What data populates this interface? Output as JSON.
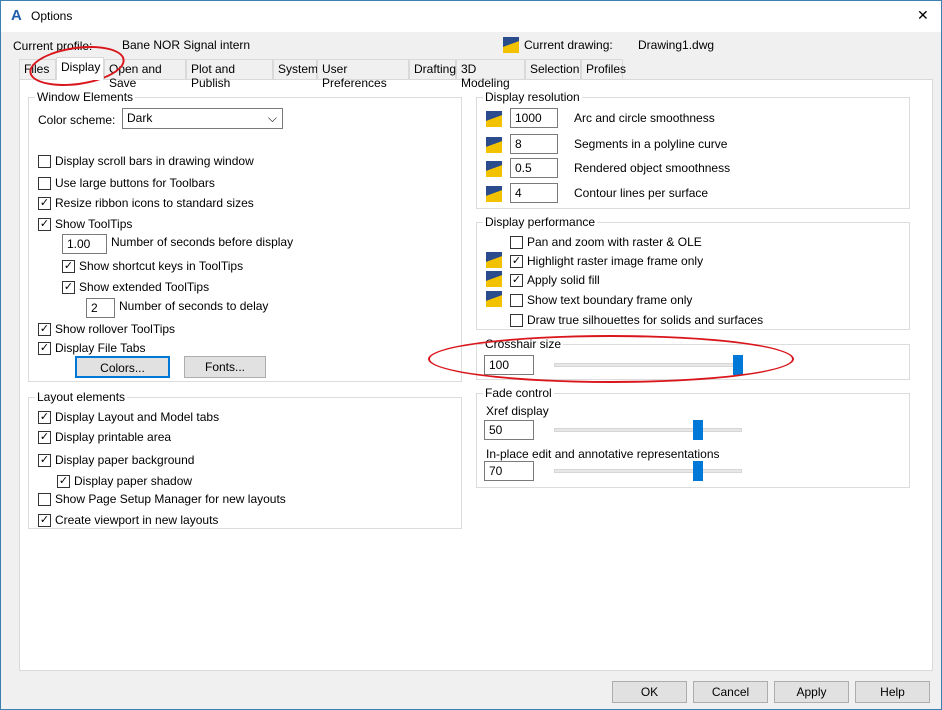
{
  "window": {
    "title": "Options",
    "close": "✕"
  },
  "header": {
    "profile_label": "Current profile:",
    "profile_value": "Bane NOR Signal intern",
    "drawing_label": "Current drawing:",
    "drawing_value": "Drawing1.dwg"
  },
  "tabs": [
    "Files",
    "Display",
    "Open and Save",
    "Plot and Publish",
    "System",
    "User Preferences",
    "Drafting",
    "3D Modeling",
    "Selection",
    "Profiles"
  ],
  "active_tab": "Display",
  "window_elements": {
    "title": "Window Elements",
    "color_scheme_label": "Color scheme:",
    "color_scheme": "Dark",
    "scroll_bars": "Display scroll bars in drawing window",
    "large_buttons": "Use large buttons for Toolbars",
    "resize_ribbon": "Resize ribbon icons to standard sizes",
    "show_tooltips": "Show ToolTips",
    "seconds_value": "1.00",
    "seconds_label": "Number of seconds before display",
    "shortcut_keys": "Show shortcut keys in ToolTips",
    "extended": "Show extended ToolTips",
    "delay_value": "2",
    "delay_label": "Number of seconds to delay",
    "rollover": "Show rollover ToolTips",
    "file_tabs": "Display File Tabs",
    "colors_btn": "Colors...",
    "fonts_btn": "Fonts..."
  },
  "layout_elements": {
    "title": "Layout elements",
    "model_tabs": "Display Layout and Model tabs",
    "printable": "Display printable area",
    "paper_bg": "Display paper background",
    "paper_shadow": "Display paper shadow",
    "page_setup": "Show Page Setup Manager for new layouts",
    "viewport": "Create viewport in new layouts"
  },
  "display_resolution": {
    "title": "Display resolution",
    "rows": [
      {
        "value": "1000",
        "label": "Arc and circle smoothness"
      },
      {
        "value": "8",
        "label": "Segments in a polyline curve"
      },
      {
        "value": "0.5",
        "label": "Rendered object smoothness"
      },
      {
        "value": "4",
        "label": "Contour lines per surface"
      }
    ]
  },
  "display_performance": {
    "title": "Display performance",
    "items": [
      {
        "label": "Pan and zoom with raster & OLE",
        "checked": false
      },
      {
        "label": "Highlight raster image frame only",
        "checked": true
      },
      {
        "label": "Apply solid fill",
        "checked": true
      },
      {
        "label": "Show text boundary frame only",
        "checked": false
      },
      {
        "label": "Draw true silhouettes for solids and surfaces",
        "checked": false
      }
    ]
  },
  "crosshair": {
    "title": "Crosshair size",
    "value": "100",
    "level": 100
  },
  "fade": {
    "title": "Fade control",
    "xref_label": "Xref display",
    "xref_value": "50",
    "xref_level": 50,
    "inplace_label": "In-place edit and annotative representations",
    "inplace_value": "70",
    "inplace_level": 70
  },
  "buttons": {
    "ok": "OK",
    "cancel": "Cancel",
    "apply": "Apply",
    "help": "Help"
  },
  "colors": {
    "accent": "#0078d7",
    "annotation": "#d9161c"
  }
}
